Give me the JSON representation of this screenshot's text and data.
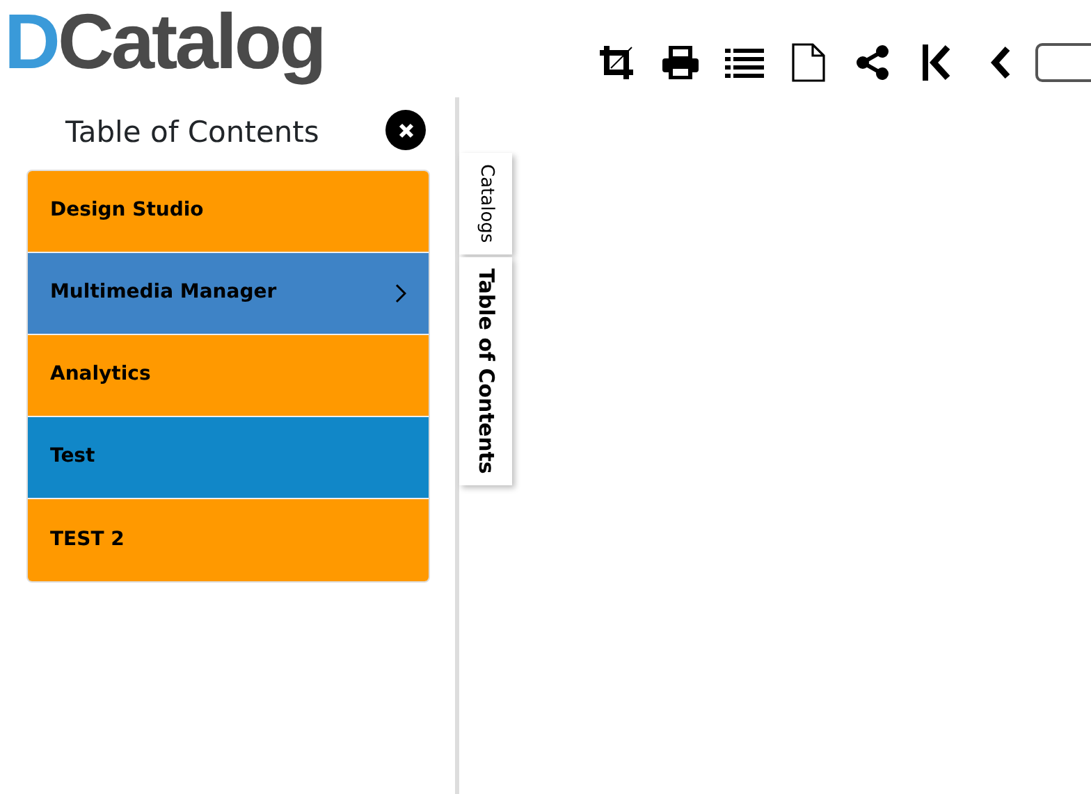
{
  "logo": [
    {
      "text": "D",
      "color": "#3a9ad9"
    },
    {
      "text": "Catalog",
      "color": "#4a4a4a"
    }
  ],
  "toolbar": [
    {
      "kind": "crop"
    },
    {
      "kind": "print"
    },
    {
      "kind": "list"
    },
    {
      "kind": "page"
    },
    {
      "kind": "share"
    },
    {
      "kind": "first"
    },
    {
      "kind": "prev"
    },
    {
      "kind": "field"
    }
  ],
  "panel": {
    "title": "Table of Contents",
    "closable": true,
    "items": [
      {
        "label": "Design Studio",
        "color": "#ff9900",
        "has_children": false
      },
      {
        "label": "Multimedia Manager",
        "color": "#3e83c6",
        "has_children": true
      },
      {
        "label": "Analytics",
        "color": "#ff9900",
        "has_children": false
      },
      {
        "label": "Test",
        "color": "#1187c8",
        "has_children": false
      },
      {
        "label": "TEST 2",
        "color": "#ff9900",
        "has_children": false
      }
    ]
  },
  "side_tabs": [
    {
      "label": "Catalogs",
      "selected": false
    },
    {
      "label": "Table of Contents",
      "selected": true
    }
  ]
}
